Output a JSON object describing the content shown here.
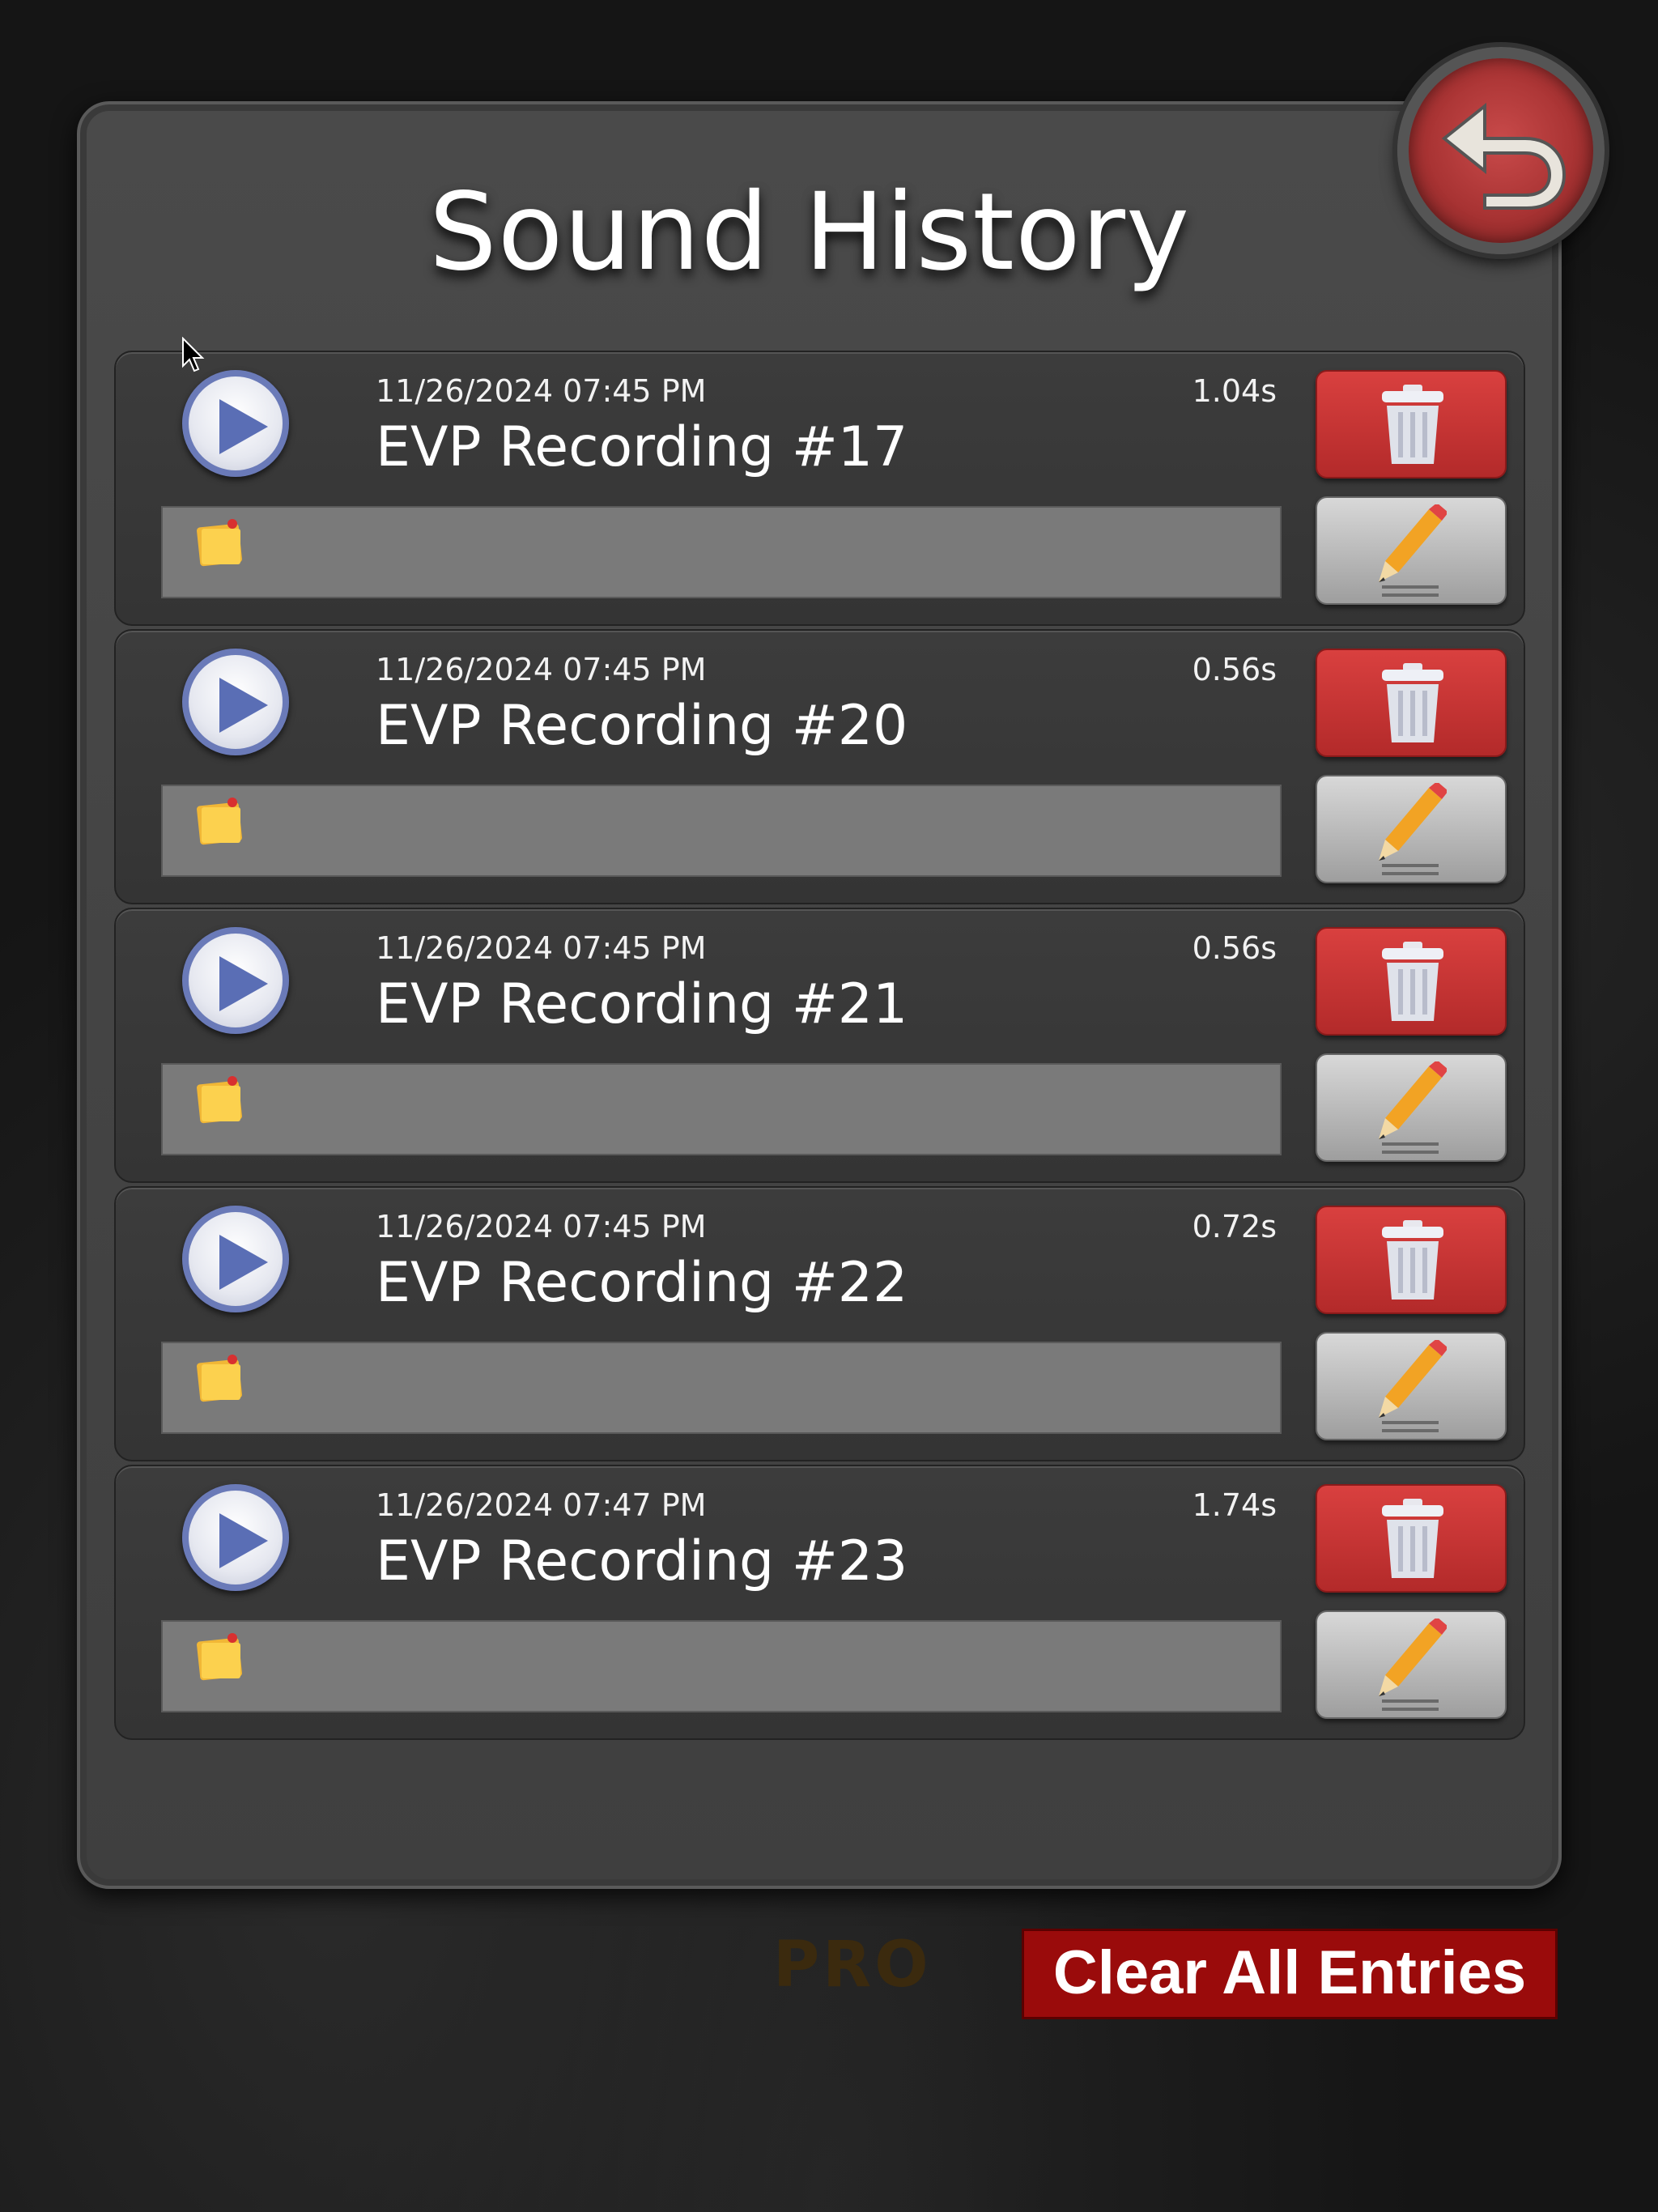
{
  "title": "Sound History",
  "back_button": {
    "icon": "undo-arrow-icon"
  },
  "recordings": [
    {
      "date": "11/26/2024 07:45 PM",
      "duration": "1.04s",
      "name": "EVP Recording #17",
      "note": ""
    },
    {
      "date": "11/26/2024 07:45 PM",
      "duration": "0.56s",
      "name": "EVP Recording #20",
      "note": ""
    },
    {
      "date": "11/26/2024 07:45 PM",
      "duration": "0.56s",
      "name": "EVP Recording #21",
      "note": ""
    },
    {
      "date": "11/26/2024 07:45 PM",
      "duration": "0.72s",
      "name": "EVP Recording #22",
      "note": ""
    },
    {
      "date": "11/26/2024 07:47 PM",
      "duration": "1.74s",
      "name": "EVP Recording #23",
      "note": ""
    }
  ],
  "footer": {
    "pro_label": "PRO",
    "clear_label": "Clear All Entries"
  },
  "colors": {
    "delete": "#c93333",
    "clear": "#9a0b0b",
    "play_ring": "#6a7ab8"
  }
}
